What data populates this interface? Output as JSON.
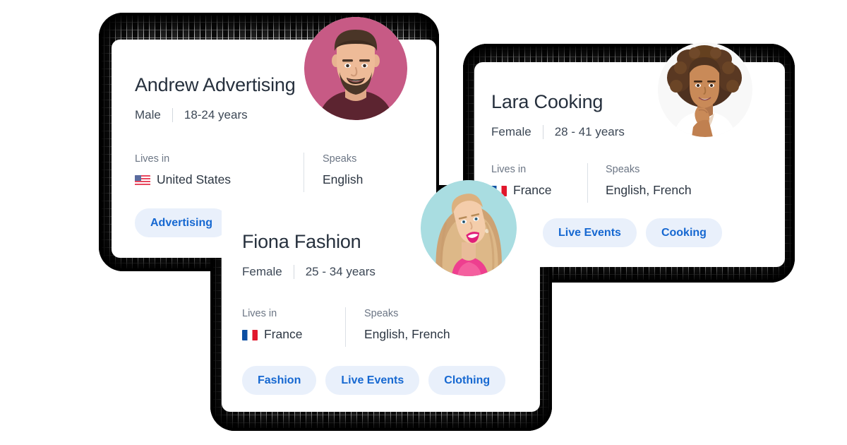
{
  "page": {
    "background_color": "#ffffff",
    "accent_color": "#1668d1",
    "chip_background_color": "#e9f0fb",
    "name_color": "#26303d",
    "label_color": "#6b7584"
  },
  "cards": [
    {
      "id": "andrew",
      "name": "Andrew Advertising",
      "gender": "Male",
      "age": "18-24 years",
      "lives_in_label": "Lives in",
      "lives_in_value": "United States",
      "lives_in_flag": "flag-united-states",
      "speaks_label": "Speaks",
      "speaks_value": "English",
      "interests": [
        "Advertising"
      ],
      "avatar": {
        "name": "avatar-andrew",
        "background_color": "#c75a85"
      }
    },
    {
      "id": "lara",
      "name": "Lara Cooking",
      "gender": "Female",
      "age": "28 - 41 years",
      "lives_in_label": "Lives in",
      "lives_in_value": "France",
      "lives_in_flag": "flag-france",
      "speaks_label": "Speaks",
      "speaks_value": "English, French",
      "interests": [
        "Live Events",
        "Cooking"
      ],
      "avatar": {
        "name": "avatar-lara",
        "background_color": "#f7f7f7"
      }
    },
    {
      "id": "fiona",
      "name": "Fiona Fashion",
      "gender": "Female",
      "age": "25 - 34 years",
      "lives_in_label": "Lives in",
      "lives_in_value": "France",
      "lives_in_flag": "flag-france",
      "speaks_label": "Speaks",
      "speaks_value": "English, French",
      "interests": [
        "Fashion",
        "Live Events",
        "Clothing"
      ],
      "avatar": {
        "name": "avatar-fiona",
        "background_color": "#a9dde1"
      }
    }
  ]
}
